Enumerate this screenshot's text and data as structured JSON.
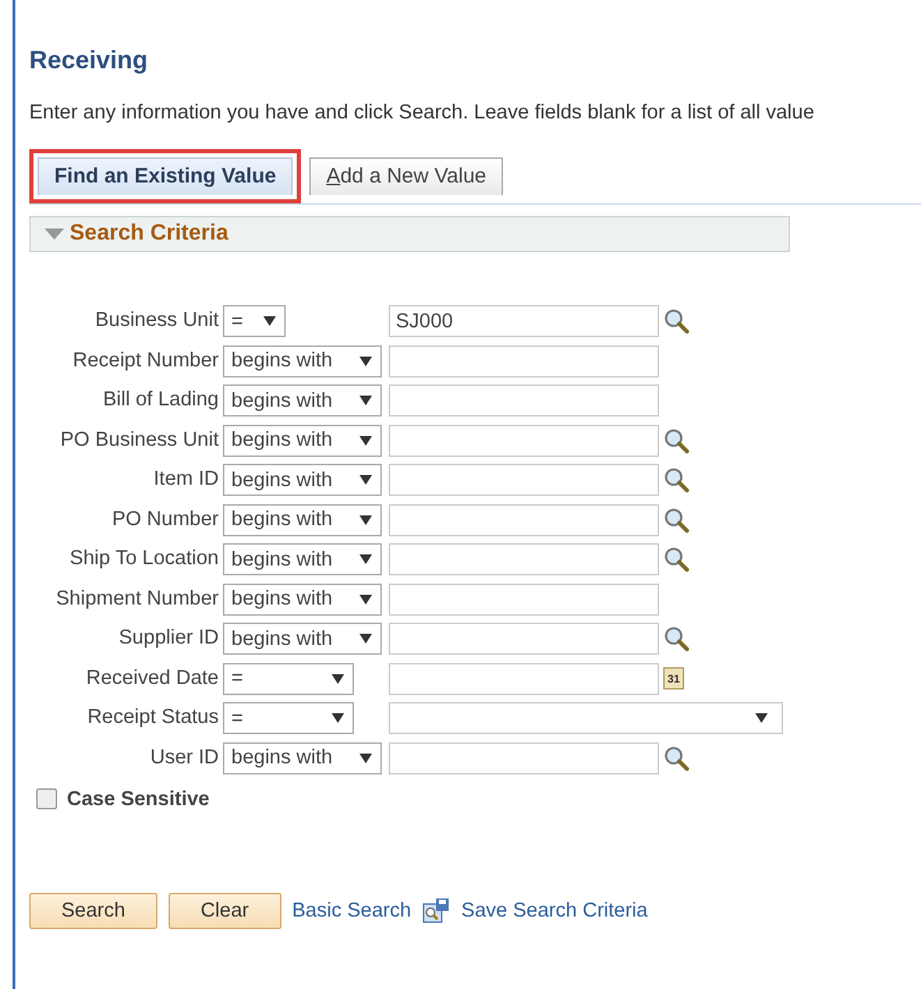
{
  "page": {
    "title": "Receiving",
    "instructions": "Enter any information you have and click Search. Leave fields blank for a list of all value"
  },
  "tabs": [
    {
      "label": "Find an Existing Value",
      "selected": true,
      "highlighted": true,
      "access_key_underlined": false
    },
    {
      "label": "Add a New Value",
      "selected": false,
      "highlighted": false,
      "access_key_underlined": true
    }
  ],
  "section": {
    "title": "Search Criteria",
    "expanded": true
  },
  "criteria": [
    {
      "label": "Business Unit",
      "operator": {
        "label": "=",
        "kind": "short"
      },
      "value": "SJ000",
      "kind": "lookup"
    },
    {
      "label": "Receipt Number",
      "operator": {
        "label": "begins with",
        "kind": "long"
      },
      "kind": "plain"
    },
    {
      "label": "Bill of Lading",
      "operator": {
        "label": "begins with",
        "kind": "long"
      },
      "kind": "plain"
    },
    {
      "label": "PO Business Unit",
      "operator": {
        "label": "begins with",
        "kind": "long"
      },
      "kind": "lookup"
    },
    {
      "label": "Item ID",
      "operator": {
        "label": "begins with",
        "kind": "long"
      },
      "kind": "lookup"
    },
    {
      "label": "PO Number",
      "operator": {
        "label": "begins with",
        "kind": "long"
      },
      "kind": "lookup"
    },
    {
      "label": "Ship To Location",
      "operator": {
        "label": "begins with",
        "kind": "long"
      },
      "kind": "lookup"
    },
    {
      "label": "Shipment Number",
      "operator": {
        "label": "begins with",
        "kind": "long"
      },
      "kind": "plain"
    },
    {
      "label": "Supplier ID",
      "operator": {
        "label": "begins with",
        "kind": "long"
      },
      "kind": "lookup"
    },
    {
      "label": "Received Date",
      "operator": {
        "label": "=",
        "kind": "medium"
      },
      "kind": "calendar",
      "calendar_icon_text": "31"
    },
    {
      "label": "Receipt Status",
      "operator": {
        "label": "=",
        "kind": "medium"
      },
      "kind": "dropdown"
    },
    {
      "label": "User ID",
      "operator": {
        "label": "begins with",
        "kind": "long"
      },
      "kind": "lookup"
    }
  ],
  "case_sensitive": {
    "label": "Case Sensitive",
    "checked": false
  },
  "actions": {
    "buttons": [
      "Search",
      "Clear"
    ],
    "links": [
      {
        "label": "Basic Search",
        "kind": "plain"
      },
      {
        "label": "Save Search Criteria",
        "kind": "save"
      }
    ]
  }
}
